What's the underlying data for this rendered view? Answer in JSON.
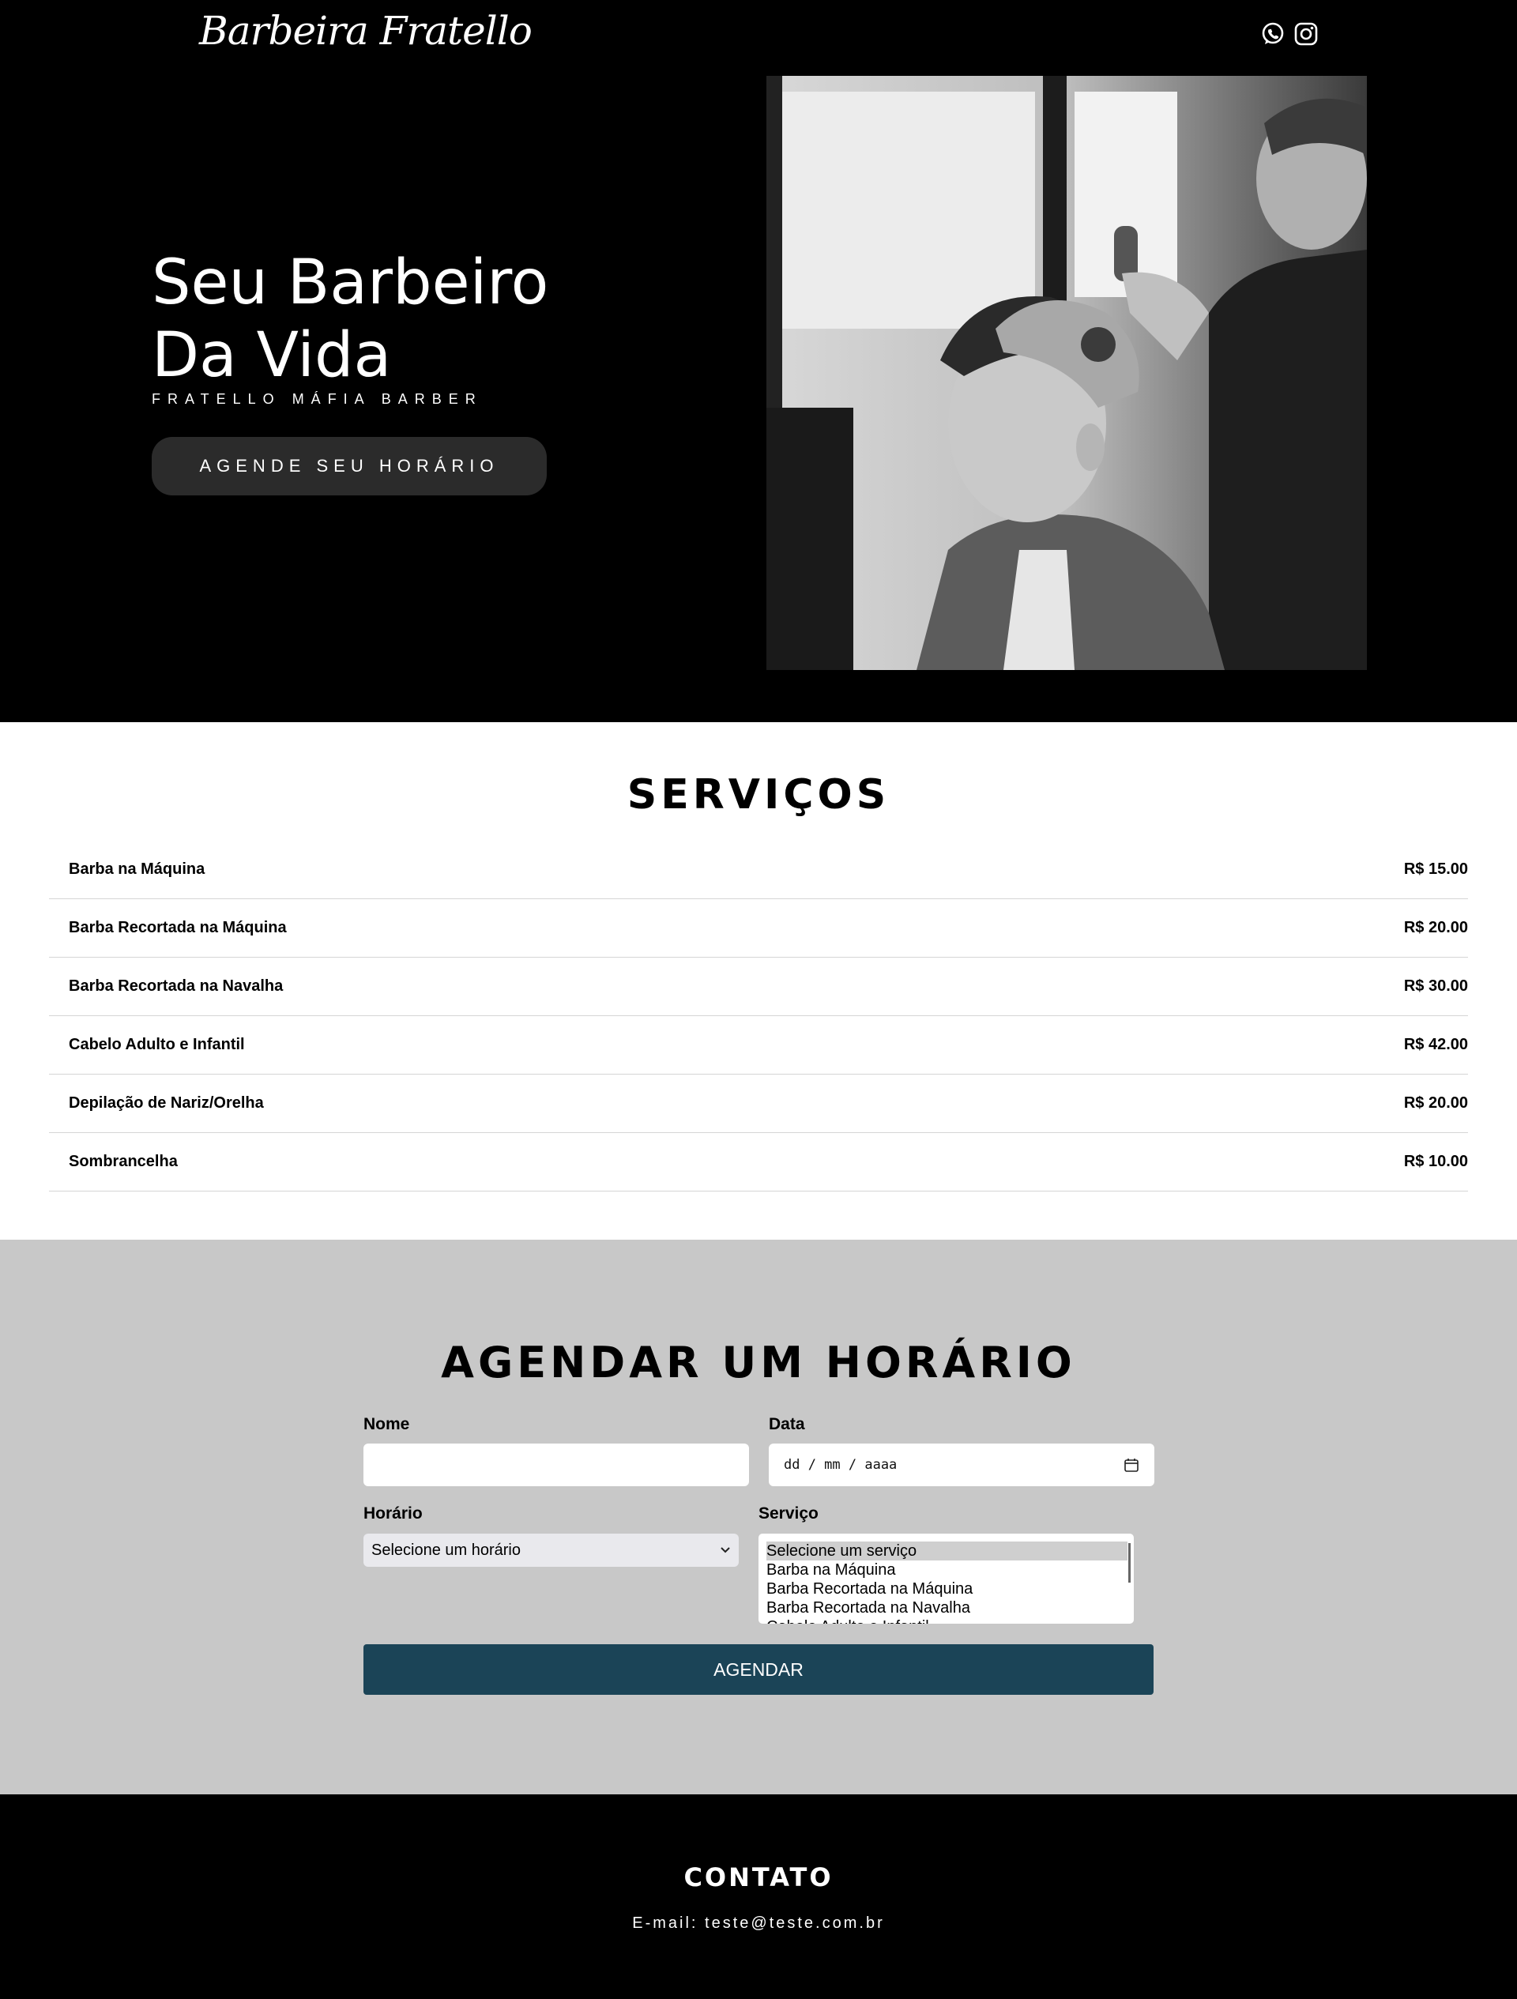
{
  "header": {
    "logo": "Barbeira Fratello",
    "social": [
      {
        "icon": "whatsapp-icon"
      },
      {
        "icon": "instagram-icon"
      }
    ]
  },
  "hero": {
    "title": "Seu Barbeiro Da Vida",
    "subtitle": "FRATELLO MÁFIA BARBER",
    "cta_label": "AGENDE SEU HORÁRIO",
    "photo_description_icon": "barber-photo"
  },
  "services": {
    "title": "SERVIÇOS",
    "items": [
      {
        "name": "Barba na Máquina",
        "price": "R$ 15.00"
      },
      {
        "name": "Barba Recortada na Máquina",
        "price": "R$ 20.00"
      },
      {
        "name": "Barba Recortada na Navalha",
        "price": "R$ 30.00"
      },
      {
        "name": "Cabelo Adulto e Infantil",
        "price": "R$ 42.00"
      },
      {
        "name": "Depilação de Nariz/Orelha",
        "price": "R$ 20.00"
      },
      {
        "name": "Sombrancelha",
        "price": "R$ 10.00"
      }
    ]
  },
  "booking": {
    "title": "AGENDAR UM HORÁRIO",
    "name_label": "Nome",
    "name_value": "",
    "date_label": "Data",
    "date_placeholder": "dd / mm / aaaa",
    "time_label": "Horário",
    "time_selected": "Selecione um horário",
    "service_label": "Serviço",
    "service_options": [
      "Selecione um serviço",
      "Barba na Máquina",
      "Barba Recortada na Máquina",
      "Barba Recortada na Navalha",
      "Cabelo Adulto e Infantil"
    ],
    "submit_label": "AGENDAR"
  },
  "footer": {
    "title": "CONTATO",
    "email": "E-mail: teste@teste.com.br"
  },
  "colors": {
    "header_bg": "#000000",
    "button_dark": "#2b2b2b",
    "booking_bg": "#c8c8c8",
    "submit_bg": "#1b4457"
  }
}
